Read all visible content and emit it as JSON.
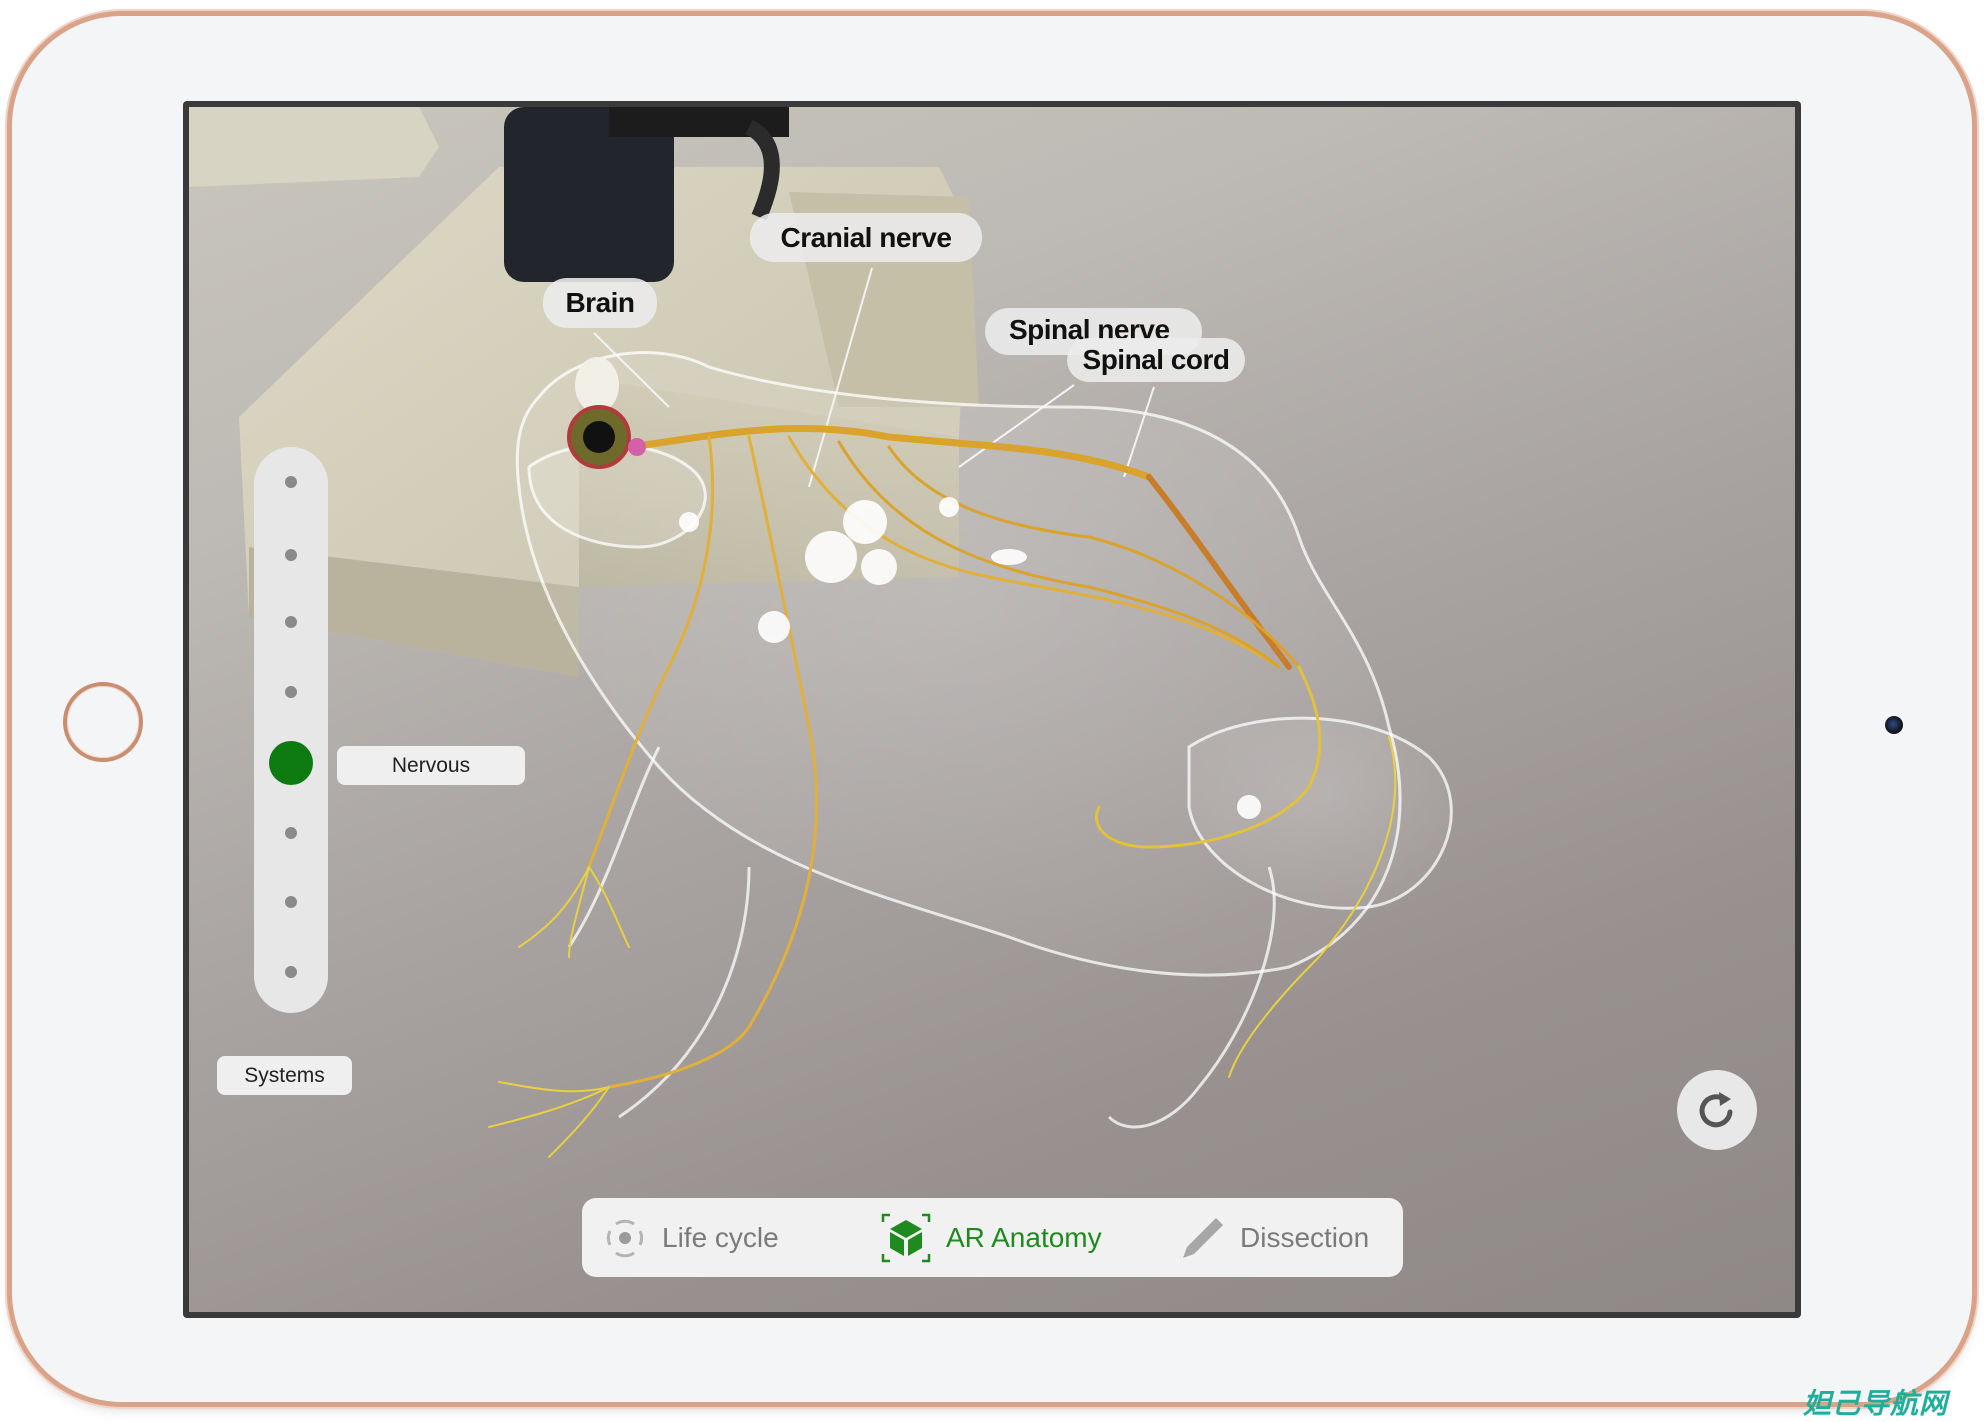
{
  "device": {
    "home_button_icon": "home-button",
    "camera_icon": "front-camera"
  },
  "scene": {
    "callouts": [
      {
        "id": "brain",
        "label": "Brain"
      },
      {
        "id": "cranial-nerve",
        "label": "Cranial nerve"
      },
      {
        "id": "spinal-nerve",
        "label": "Spinal nerve"
      },
      {
        "id": "spinal-cord",
        "label": "Spinal cord"
      }
    ]
  },
  "systems_slider": {
    "title": "Systems",
    "selected_label": "Nervous",
    "stops": 9,
    "selected_index": 4,
    "active_color": "#0e7a12",
    "inactive_color": "#8a8a8a"
  },
  "toolbar": {
    "tabs": [
      {
        "label": "Life cycle",
        "icon": "life-cycle-icon",
        "active": false
      },
      {
        "label": "AR Anatomy",
        "icon": "ar-cube-icon",
        "active": true
      },
      {
        "label": "Dissection",
        "icon": "pencil-icon",
        "active": false
      }
    ],
    "active_color": "#1f8a1f",
    "inactive_color": "#7b7b7b"
  },
  "reset_button": {
    "icon": "reset-rotate-icon"
  },
  "watermark": "妲己导航网"
}
